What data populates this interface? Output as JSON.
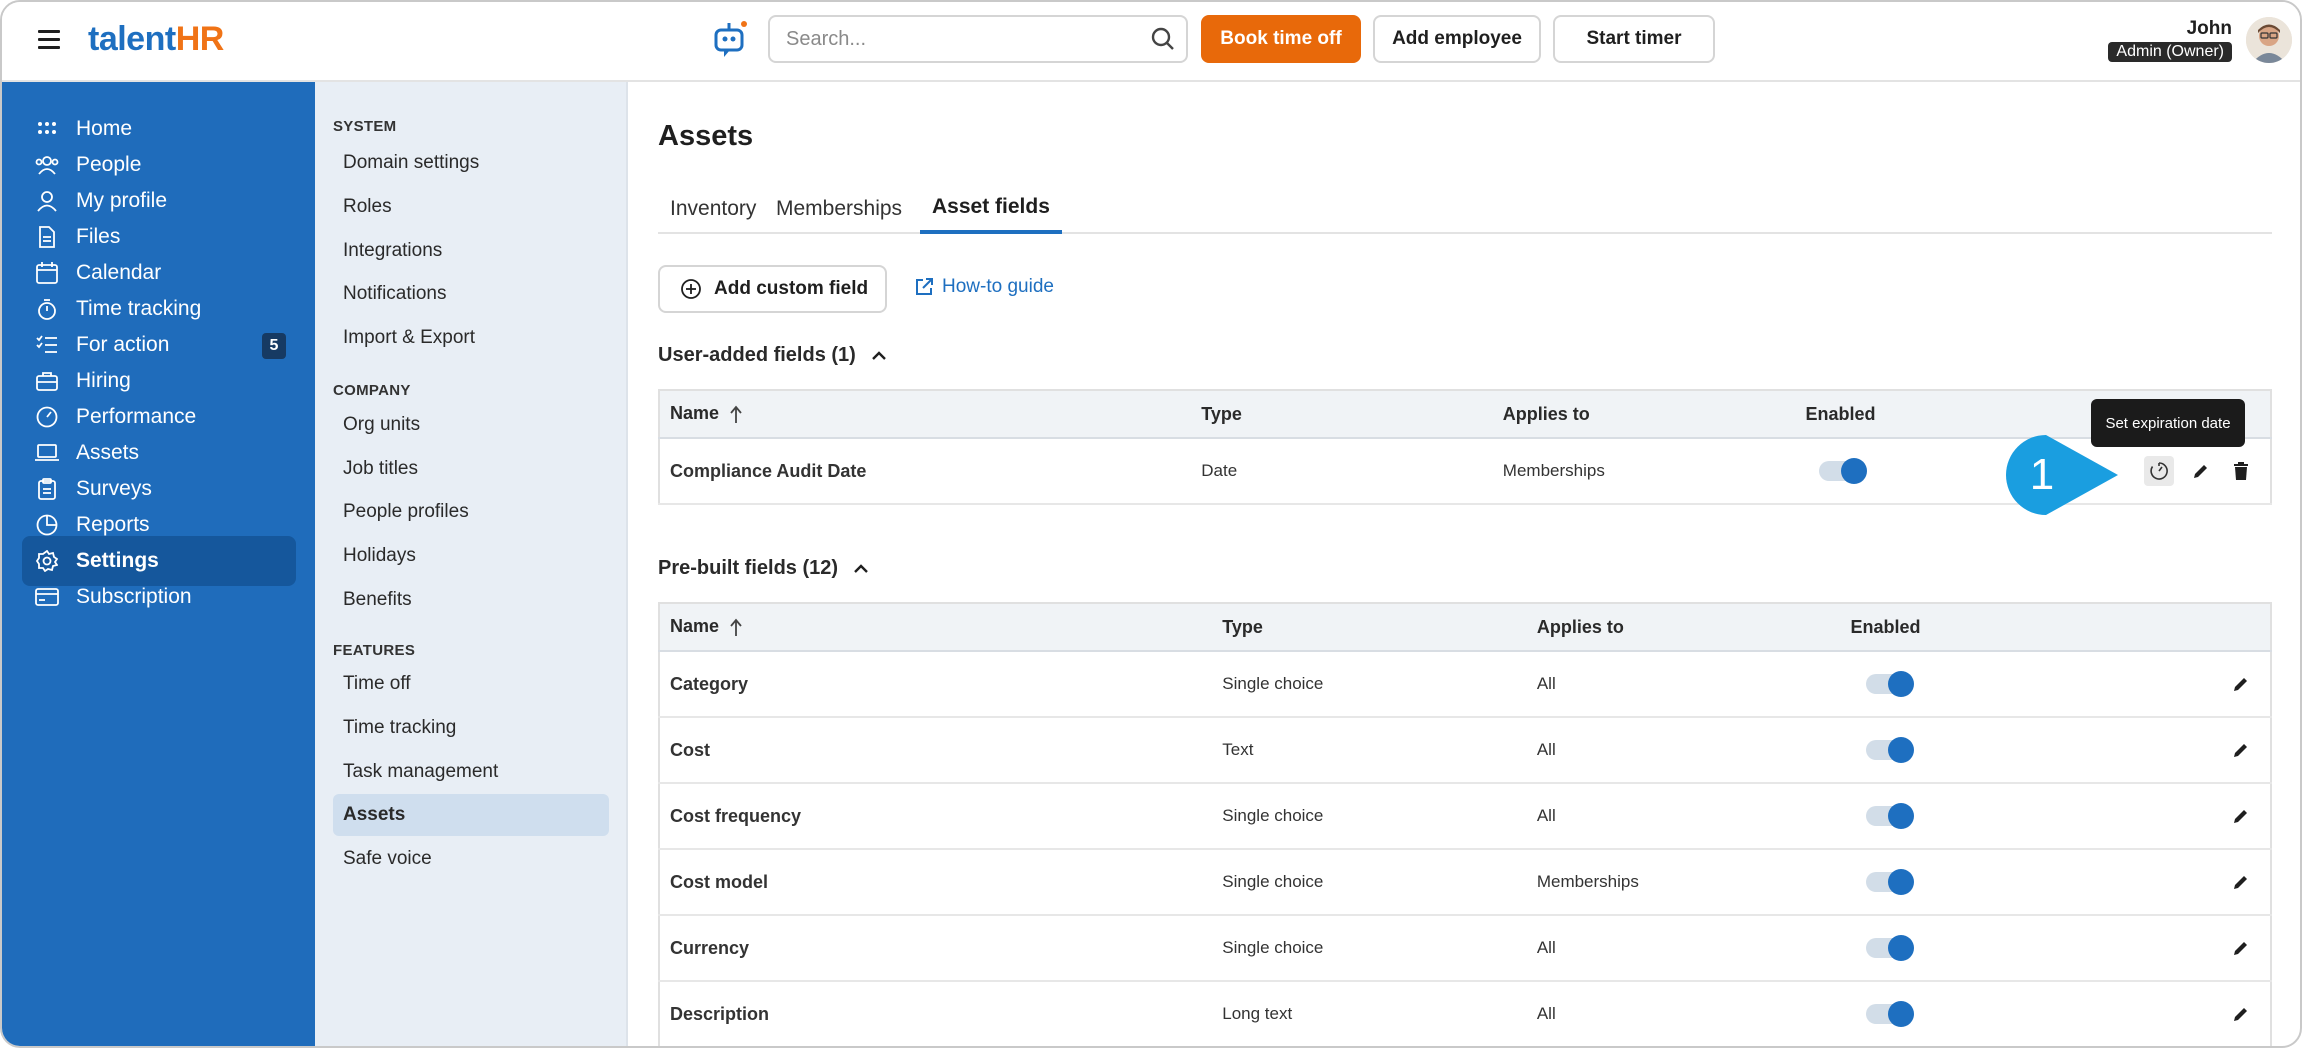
{
  "app": {
    "logo_part1": "talent",
    "logo_part2": "HR",
    "brand_color": "#1e6fc0",
    "accent_color": "#e8690a"
  },
  "topbar": {
    "search_placeholder": "Search...",
    "book_time_off": "Book time off",
    "add_employee": "Add employee",
    "start_timer": "Start timer",
    "user_name": "John",
    "user_role": "Admin (Owner)"
  },
  "sidebar": {
    "items": [
      {
        "label": "Home",
        "icon": "grid-icon"
      },
      {
        "label": "People",
        "icon": "people-icon"
      },
      {
        "label": "My profile",
        "icon": "user-icon"
      },
      {
        "label": "Files",
        "icon": "file-icon"
      },
      {
        "label": "Calendar",
        "icon": "calendar-icon"
      },
      {
        "label": "Time tracking",
        "icon": "stopwatch-icon"
      },
      {
        "label": "For action",
        "icon": "checklist-icon",
        "badge": "5"
      },
      {
        "label": "Hiring",
        "icon": "briefcase-icon"
      },
      {
        "label": "Performance",
        "icon": "gauge-icon"
      },
      {
        "label": "Assets",
        "icon": "laptop-icon"
      },
      {
        "label": "Surveys",
        "icon": "clipboard-icon"
      },
      {
        "label": "Reports",
        "icon": "pie-chart-icon"
      },
      {
        "label": "Settings",
        "icon": "gear-icon",
        "active": true
      },
      {
        "label": "Subscription",
        "icon": "card-icon"
      }
    ]
  },
  "subnav": {
    "system_heading": "SYSTEM",
    "system_items": [
      "Domain settings",
      "Roles",
      "Integrations",
      "Notifications",
      "Import & Export"
    ],
    "company_heading": "COMPANY",
    "company_items": [
      "Org units",
      "Job titles",
      "People profiles",
      "Holidays",
      "Benefits"
    ],
    "features_heading": "FEATURES",
    "features_items": [
      "Time off",
      "Time tracking",
      "Task management",
      "Assets",
      "Safe voice"
    ],
    "active": "Assets"
  },
  "main": {
    "title": "Assets",
    "tabs": [
      "Inventory",
      "Memberships",
      "Asset fields"
    ],
    "active_tab": "Asset fields",
    "add_custom_field": "Add custom field",
    "howto": "How-to guide",
    "user_section": "User-added fields (1)",
    "prebuilt_section": "Pre-built fields (12)",
    "columns": {
      "name": "Name",
      "type": "Type",
      "applies": "Applies to",
      "enabled": "Enabled"
    },
    "user_fields": [
      {
        "name": "Compliance Audit Date",
        "type": "Date",
        "applies": "Memberships",
        "enabled": true
      }
    ],
    "prebuilt_fields": [
      {
        "name": "Category",
        "type": "Single choice",
        "applies": "All",
        "enabled": true
      },
      {
        "name": "Cost",
        "type": "Text",
        "applies": "All",
        "enabled": true
      },
      {
        "name": "Cost frequency",
        "type": "Single choice",
        "applies": "All",
        "enabled": true
      },
      {
        "name": "Cost model",
        "type": "Single choice",
        "applies": "Memberships",
        "enabled": true
      },
      {
        "name": "Currency",
        "type": "Single choice",
        "applies": "All",
        "enabled": true
      },
      {
        "name": "Description",
        "type": "Long text",
        "applies": "All",
        "enabled": true
      }
    ],
    "tooltip": "Set expiration date",
    "callout_number": "1"
  }
}
